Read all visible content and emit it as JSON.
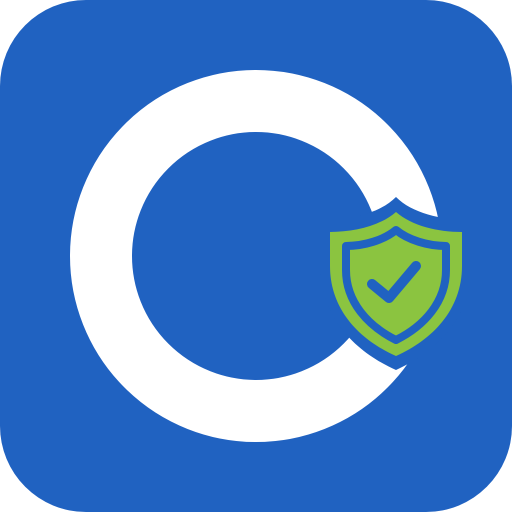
{
  "app_icon": {
    "icon_name": "security-app-icon",
    "background_color": "#2062C1",
    "ring_color": "#FFFFFF",
    "shield": {
      "icon_name": "shield-check-icon",
      "fill_color": "#8BC440",
      "outline_color": "#2062C1",
      "check_color": "#2062C1"
    }
  }
}
